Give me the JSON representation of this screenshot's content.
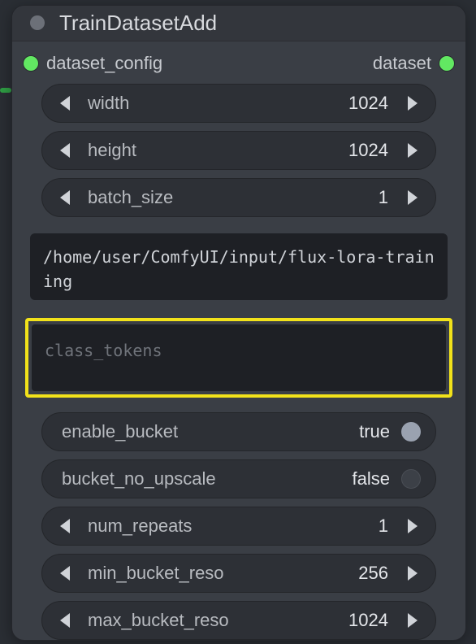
{
  "node": {
    "title": "TrainDatasetAdd",
    "input_slot_label": "dataset_config",
    "output_slot_label": "dataset"
  },
  "widgets": {
    "width": {
      "label": "width",
      "value": "1024"
    },
    "height": {
      "label": "height",
      "value": "1024"
    },
    "batch_size": {
      "label": "batch_size",
      "value": "1"
    },
    "num_repeats": {
      "label": "num_repeats",
      "value": "1"
    },
    "min_bucket_reso": {
      "label": "min_bucket_reso",
      "value": "256"
    },
    "max_bucket_reso": {
      "label": "max_bucket_reso",
      "value": "1024"
    }
  },
  "toggles": {
    "enable_bucket": {
      "label": "enable_bucket",
      "value": "true",
      "on": true
    },
    "bucket_no_upscale": {
      "label": "bucket_no_upscale",
      "value": "false",
      "on": false
    }
  },
  "path_text": "/home/user/ComfyUI/input/flux-lora-training",
  "class_tokens_placeholder": "class_tokens"
}
